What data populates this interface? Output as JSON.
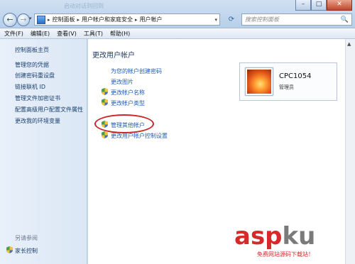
{
  "window": {
    "ghost_title": "启动对话到回到",
    "controls": {
      "minimize": "–",
      "maximize": "□",
      "close": "✕"
    }
  },
  "nav": {
    "back_icon": "back-arrow-icon",
    "forward_icon": "forward-arrow-icon",
    "back_glyph": "←",
    "forward_glyph": "→",
    "history_glyph": "▾"
  },
  "address": {
    "crumbs": [
      "控制面板",
      "用户帐户和家庭安全",
      "用户帐户"
    ],
    "separator": "▸",
    "dropdown": "▾",
    "refresh": "⟳"
  },
  "search": {
    "placeholder": "搜索控制面板",
    "icon": "🔍"
  },
  "menu": [
    "文件(F)",
    "编辑(E)",
    "查看(V)",
    "工具(T)",
    "帮助(H)"
  ],
  "sidebar": {
    "items": [
      "控制面板主页",
      "管理您的凭据",
      "创建密码重设盘",
      "链接联机 ID",
      "管理文件加密证书",
      "配置高级用户配置文件属性",
      "更改我的环境变量"
    ],
    "see_also": "另请参阅",
    "family": "家长控制"
  },
  "main": {
    "title": "更改用户帐户",
    "links": [
      "为您的帐户创建密码",
      "更改图片",
      "更改帐户名称",
      "更改帐户类型",
      "管理其他帐户",
      "更改用户帐户控制设置"
    ]
  },
  "user": {
    "name": "CPC1054",
    "role": "管理员"
  },
  "watermark": {
    "asp": "asp",
    "ku": "ku",
    "cn": ".com",
    "sub": "免费网站源码下载站！"
  }
}
